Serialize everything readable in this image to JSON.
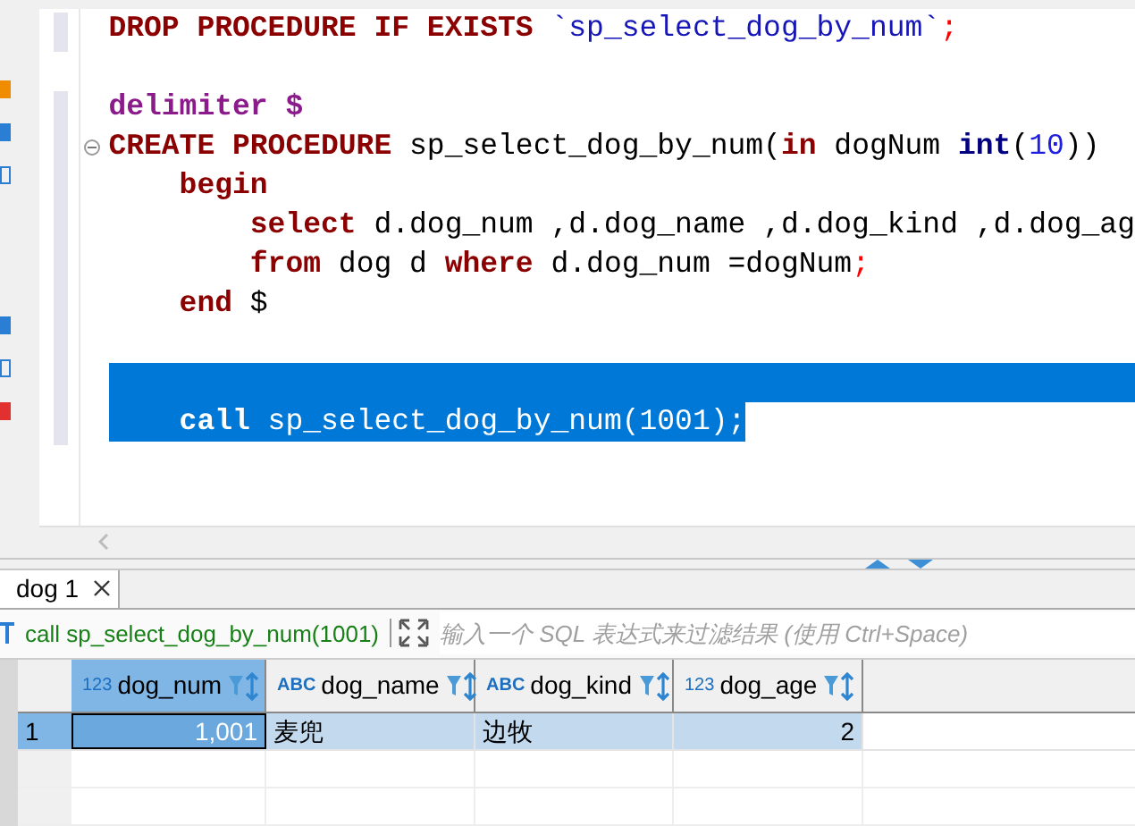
{
  "editor": {
    "lines": [
      {
        "selected": false,
        "fold_marker": false,
        "tokens": [
          {
            "text": "DROP PROCEDURE IF EXISTS ",
            "kind": "keyword"
          },
          {
            "text": "`sp_select_dog_by_num`",
            "kind": "string"
          },
          {
            "text": ";",
            "kind": "punct"
          }
        ]
      },
      {
        "selected": false,
        "fold_marker": false
      },
      {
        "selected": false,
        "fold_marker": false,
        "tokens": [
          {
            "text": "delimiter $",
            "kind": "directive"
          }
        ]
      },
      {
        "selected": false,
        "fold_marker": true,
        "tokens": [
          {
            "text": "CREATE PROCEDURE ",
            "kind": "keyword"
          },
          {
            "text": "sp_select_dog_by_num(",
            "kind": "plain"
          },
          {
            "text": "in",
            "kind": "keyword"
          },
          {
            "text": " dogNum ",
            "kind": "plain"
          },
          {
            "text": "int",
            "kind": "type"
          },
          {
            "text": "(",
            "kind": "plain"
          },
          {
            "text": "10",
            "kind": "number"
          },
          {
            "text": "))",
            "kind": "plain"
          }
        ]
      },
      {
        "selected": false,
        "fold_marker": false,
        "tokens": [
          {
            "text": "    begin",
            "kind": "keyword"
          }
        ]
      },
      {
        "selected": false,
        "fold_marker": false,
        "tokens": [
          {
            "text": "        select",
            "kind": "keyword"
          },
          {
            "text": " d.dog_num ,d.dog_name ,d.dog_kind ,d.dog_ag",
            "kind": "plain"
          }
        ]
      },
      {
        "selected": false,
        "fold_marker": false,
        "tokens": [
          {
            "text": "        from",
            "kind": "keyword"
          },
          {
            "text": " dog d ",
            "kind": "plain"
          },
          {
            "text": "where",
            "kind": "keyword"
          },
          {
            "text": " d.dog_num =dogNum",
            "kind": "plain"
          },
          {
            "text": ";",
            "kind": "punct"
          }
        ]
      },
      {
        "selected": false,
        "fold_marker": false,
        "tokens": [
          {
            "text": "    end",
            "kind": "keyword"
          },
          {
            "text": " $",
            "kind": "plain"
          }
        ]
      },
      {
        "selected": false,
        "fold_marker": false
      },
      {
        "selected": true,
        "fold_marker": false
      },
      {
        "selected": true,
        "fold_marker": false,
        "tokens": [
          {
            "text": "    call",
            "kind": "keyword"
          },
          {
            "text": " sp_select_dog_by_num(1001);",
            "kind": "plain"
          }
        ]
      }
    ]
  },
  "result_tabs": [
    {
      "label": "dog 1",
      "selected": true
    }
  ],
  "filter_bar": {
    "query": "call sp_select_dog_by_num(1001)",
    "placeholder": "输入一个 SQL 表达式来过滤结果 (使用 Ctrl+Space)"
  },
  "table": {
    "columns": [
      {
        "kind": "number",
        "type_label": "123",
        "name": "dog_num",
        "selected": true
      },
      {
        "kind": "text",
        "type_label": "ABC",
        "name": "dog_name",
        "selected": false
      },
      {
        "kind": "text",
        "type_label": "ABC",
        "name": "dog_kind",
        "selected": false
      },
      {
        "kind": "number",
        "type_label": "123",
        "name": "dog_age",
        "selected": false
      }
    ],
    "rows": [
      {
        "number": "1",
        "selected": true,
        "cells": [
          "1,001",
          "麦兜",
          "边牧",
          "2"
        ]
      }
    ]
  }
}
